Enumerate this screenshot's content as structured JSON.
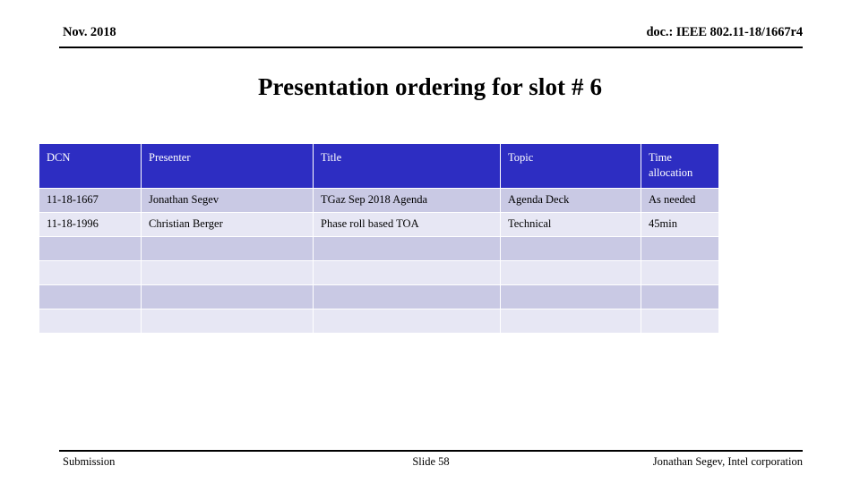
{
  "header": {
    "left": "Nov. 2018",
    "right": "doc.: IEEE 802.11-18/1667r4"
  },
  "title": "Presentation ordering for slot # 6",
  "table": {
    "columns": [
      "DCN",
      "Presenter",
      "Title",
      "Topic",
      "Time allocation"
    ],
    "rows": [
      {
        "dcn": "11-18-1667",
        "presenter": "Jonathan Segev",
        "title": "TGaz Sep 2018 Agenda",
        "topic": "Agenda Deck",
        "time": "As needed"
      },
      {
        "dcn": "11-18-1996",
        "presenter": "Christian Berger",
        "title": "Phase roll based TOA",
        "topic": "Technical",
        "time": "45min"
      },
      {
        "dcn": "",
        "presenter": "",
        "title": "",
        "topic": "",
        "time": ""
      },
      {
        "dcn": "",
        "presenter": "",
        "title": "",
        "topic": "",
        "time": ""
      },
      {
        "dcn": "",
        "presenter": "",
        "title": "",
        "topic": "",
        "time": ""
      },
      {
        "dcn": "",
        "presenter": "",
        "title": "",
        "topic": "",
        "time": ""
      }
    ],
    "header_background": "#2d2dc2",
    "header_text_color": "#ffffff",
    "row_dark_background": "#c9c9e4",
    "row_light_background": "#e7e7f4"
  },
  "footer": {
    "left": "Submission",
    "center": "Slide 58",
    "right": "Jonathan Segev, Intel corporation"
  }
}
